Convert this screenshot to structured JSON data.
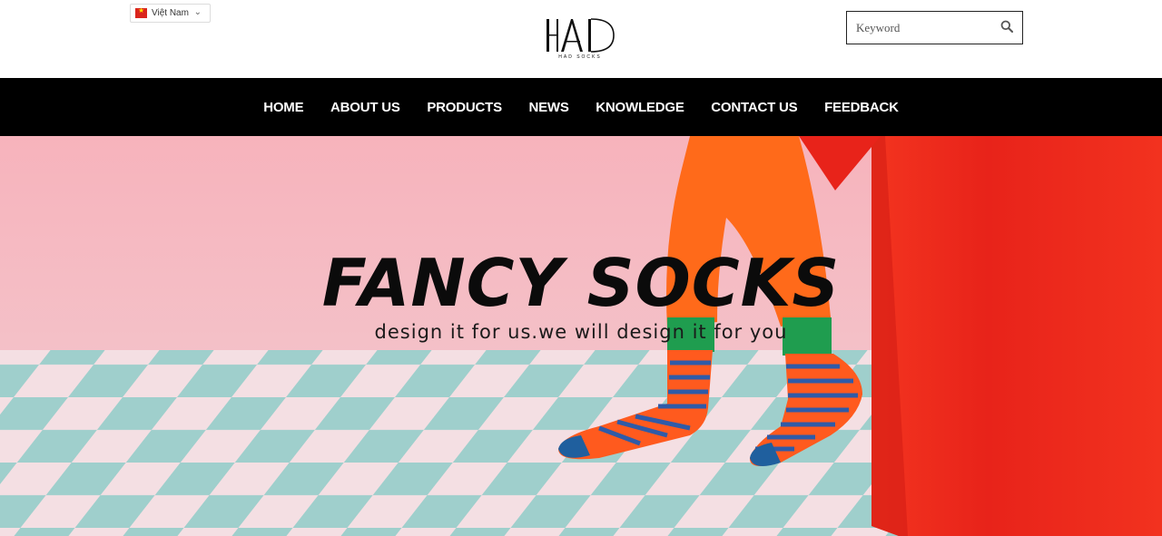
{
  "language": {
    "label": "Việt Nam",
    "flag_icon": "vietnam-flag-icon"
  },
  "logo": {
    "text": "HAD",
    "tagline": "HAD SOCKS"
  },
  "search": {
    "placeholder": "Keyword",
    "value": "",
    "icon": "search-icon"
  },
  "nav": {
    "items": [
      {
        "label": "HOME"
      },
      {
        "label": "ABOUT US"
      },
      {
        "label": "PRODUCTS"
      },
      {
        "label": "NEWS"
      },
      {
        "label": "KNOWLEDGE"
      },
      {
        "label": "CONTACT US"
      },
      {
        "label": "FEEDBACK"
      }
    ]
  },
  "hero": {
    "title": "FANCY SOCKS",
    "subtitle": "design it for us.we will design it for you"
  },
  "colors": {
    "nav_bg": "#000000",
    "wall_pink": "#f6b9c0",
    "floor_teal": "#9fcfcc",
    "floor_pink": "#f4dfe3",
    "box_red": "#ee2a1e",
    "pants_orange": "#ff6a1a"
  }
}
